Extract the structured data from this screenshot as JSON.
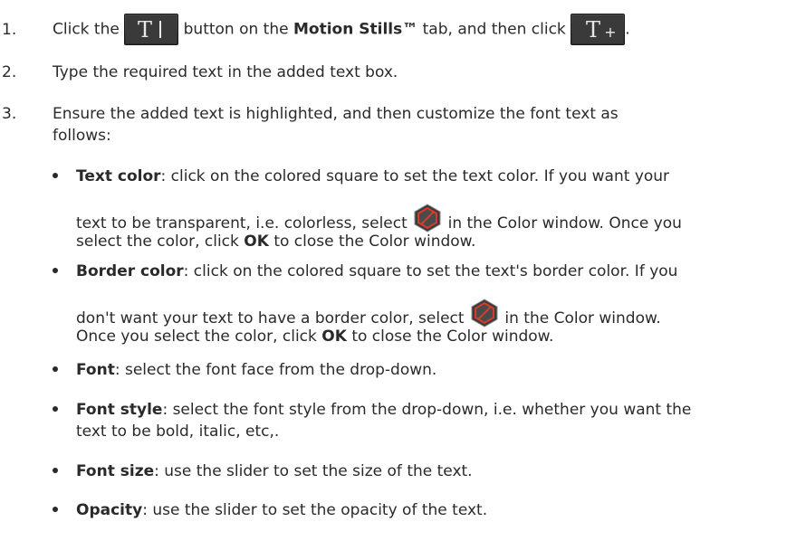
{
  "steps": [
    {
      "number": "1.",
      "part1": "Click the",
      "part2": "button on the",
      "tab_name": "Motion Stills™",
      "part3": "tab, and then click",
      "part4": "."
    },
    {
      "number": "2.",
      "text": "Type the required text in the added text box."
    },
    {
      "number": "3.",
      "line1": "Ensure the added text is highlighted, and then customize the font text as",
      "line2": "follows:"
    }
  ],
  "bullets": {
    "text_color": {
      "term": "Text color",
      "line1": ": click on the colored square to set the text color. If you want your",
      "line2a": "text to be transparent, i.e. colorless, select",
      "line2b": "in the Color window. Once you",
      "line3a": "select the color, click",
      "ok": "OK",
      "line3b": "to close the Color window."
    },
    "border_color": {
      "term": "Border color",
      "line1": ": click on the colored square to set the text's border color. If you",
      "line2a": "don't want your text to have a border color, select",
      "line2b": "in the Color window.",
      "line3a": "Once you select the color, click",
      "ok": "OK",
      "line3b": "to close the Color window."
    },
    "font": {
      "term": "Font",
      "text": ": select the font face from the drop-down."
    },
    "font_style": {
      "term": "Font style",
      "line1": ": select the font style from the drop-down, i.e. whether you want the",
      "line2": "text to be bold, italic, etc,."
    },
    "font_size": {
      "term": "Font size",
      "text": ": use the slider to set the size of the text."
    },
    "opacity": {
      "term": "Opacity",
      "text": ": use the slider to set the opacity of the text."
    }
  },
  "icons": {
    "text_tool": "text-tool-icon",
    "add_text": "add-text-icon",
    "transparent_color": "transparent-color-icon",
    "icon_fill": "#3a3a3a",
    "hex_red": "#d93a2b"
  }
}
